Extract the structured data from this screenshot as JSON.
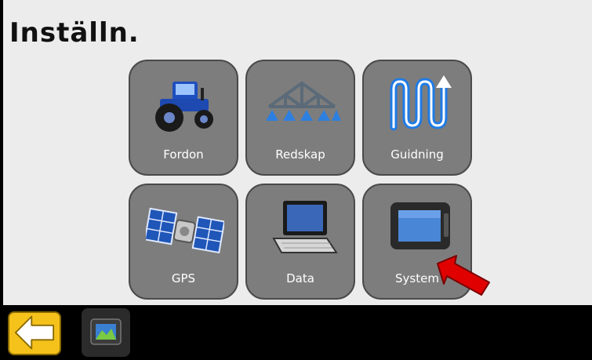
{
  "page": {
    "title": "Inställn."
  },
  "menu": {
    "tiles": [
      {
        "label": "Fordon",
        "icon": "tractor-icon"
      },
      {
        "label": "Redskap",
        "icon": "sprayer-boom-icon"
      },
      {
        "label": "Guidning",
        "icon": "guidance-path-icon"
      },
      {
        "label": "GPS",
        "icon": "satellite-icon"
      },
      {
        "label": "Data",
        "icon": "laptop-icon"
      },
      {
        "label": "System",
        "icon": "display-console-icon"
      }
    ]
  },
  "bottombar": {
    "back_icon": "back-arrow-icon",
    "home_icon": "display-console-icon"
  },
  "colors": {
    "tile": "#7d7d7d",
    "back_button": "#f5c21c",
    "annotation_arrow": "#e00000"
  }
}
